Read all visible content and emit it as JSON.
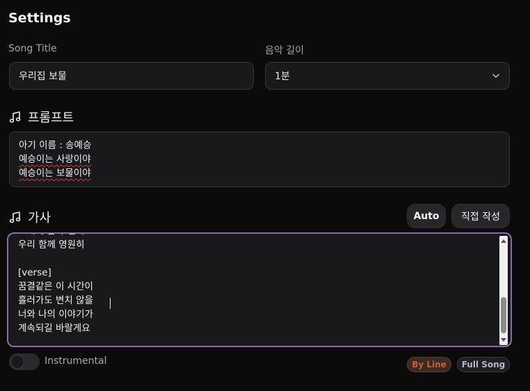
{
  "settings": {
    "title": "Settings"
  },
  "song_title": {
    "label": "Song Title",
    "value": "우리집 보물"
  },
  "music_length": {
    "label": "음악 길이",
    "value": "1분"
  },
  "prompt": {
    "heading": "프롬프트",
    "lines": [
      "아기 이름 : 송예승",
      "예승이는 사랑이야",
      "예승이는 보물이야"
    ]
  },
  "lyrics": {
    "heading": "가사",
    "auto_button": "Auto",
    "manual_button": "직접 작성",
    "text": "노래에 담아 전해요\n우리 함께 영원히\n\n[verse]\n꿈결같은 이 시간이\n흘러가도 변치 않을\n너와 나의 이야기가\n계속되길 바랄게요"
  },
  "instrumental": {
    "label": "Instrumental",
    "enabled": false
  },
  "mode_chips": {
    "by_line": "By Line",
    "full_song": "Full Song"
  },
  "colors": {
    "accent_border": "#8a6bb0",
    "by_line": "#c2603c"
  },
  "icons": {
    "note": "music-note-icon",
    "chevron": "chevron-down-icon"
  }
}
